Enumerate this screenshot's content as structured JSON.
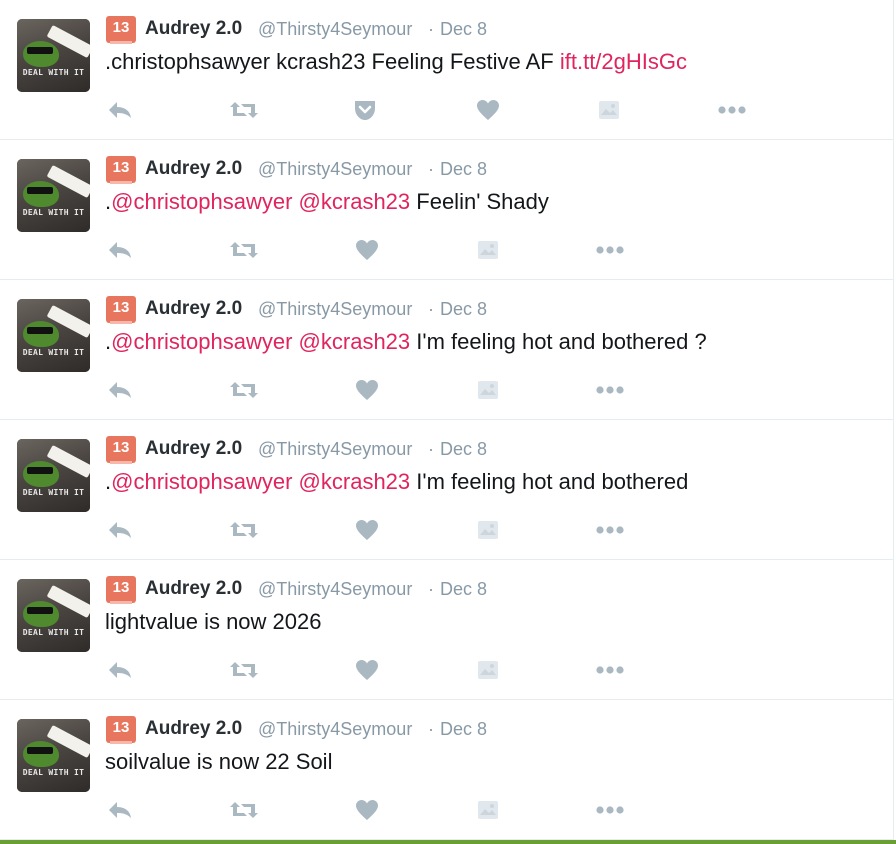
{
  "colors": {
    "accent": "#e0245e",
    "badge": "#e8765e",
    "muted": "#8899a6",
    "icon": "#aab8c2"
  },
  "tweets": [
    {
      "badge": "13",
      "name": "Audrey 2.0",
      "handle": "@Thirsty4Seymour",
      "separator": "·",
      "date": "Dec 8",
      "avatar_text": "DEAL WITH IT",
      "text_parts": [
        {
          "t": ".christophsawyer kcrash23 Feeling Festive AF ",
          "k": "plain"
        },
        {
          "t": "ift.tt/2gHIsGc",
          "k": "link"
        }
      ],
      "actions": [
        "reply-icon",
        "retweet-icon",
        "pocket-icon",
        "like-icon",
        "media-icon",
        "more-icon"
      ]
    },
    {
      "badge": "13",
      "name": "Audrey 2.0",
      "handle": "@Thirsty4Seymour",
      "separator": "·",
      "date": "Dec 8",
      "avatar_text": "DEAL WITH IT",
      "text_parts": [
        {
          "t": ".",
          "k": "plain"
        },
        {
          "t": "@christophsawyer",
          "k": "mention"
        },
        {
          "t": " ",
          "k": "plain"
        },
        {
          "t": "@kcrash23",
          "k": "mention"
        },
        {
          "t": " Feelin' Shady",
          "k": "plain"
        }
      ],
      "actions": [
        "reply-icon",
        "retweet-icon",
        "like-icon",
        "media-icon",
        "more-icon"
      ]
    },
    {
      "badge": "13",
      "name": "Audrey 2.0",
      "handle": "@Thirsty4Seymour",
      "separator": "·",
      "date": "Dec 8",
      "avatar_text": "DEAL WITH IT",
      "text_parts": [
        {
          "t": ".",
          "k": "plain"
        },
        {
          "t": "@christophsawyer",
          "k": "mention"
        },
        {
          "t": " ",
          "k": "plain"
        },
        {
          "t": "@kcrash23",
          "k": "mention"
        },
        {
          "t": " I'm feeling hot and bothered ?",
          "k": "plain"
        }
      ],
      "actions": [
        "reply-icon",
        "retweet-icon",
        "like-icon",
        "media-icon",
        "more-icon"
      ]
    },
    {
      "badge": "13",
      "name": "Audrey 2.0",
      "handle": "@Thirsty4Seymour",
      "separator": "·",
      "date": "Dec 8",
      "avatar_text": "DEAL WITH IT",
      "text_parts": [
        {
          "t": ".",
          "k": "plain"
        },
        {
          "t": "@christophsawyer",
          "k": "mention"
        },
        {
          "t": " ",
          "k": "plain"
        },
        {
          "t": "@kcrash23",
          "k": "mention"
        },
        {
          "t": " I'm feeling hot and bothered",
          "k": "plain"
        }
      ],
      "actions": [
        "reply-icon",
        "retweet-icon",
        "like-icon",
        "media-icon",
        "more-icon"
      ]
    },
    {
      "badge": "13",
      "name": "Audrey 2.0",
      "handle": "@Thirsty4Seymour",
      "separator": "·",
      "date": "Dec 8",
      "avatar_text": "DEAL WITH IT",
      "text_parts": [
        {
          "t": "lightvalue is now 2026",
          "k": "plain"
        }
      ],
      "actions": [
        "reply-icon",
        "retweet-icon",
        "like-icon",
        "media-icon",
        "more-icon"
      ]
    },
    {
      "badge": "13",
      "name": "Audrey 2.0",
      "handle": "@Thirsty4Seymour",
      "separator": "·",
      "date": "Dec 8",
      "avatar_text": "DEAL WITH IT",
      "text_parts": [
        {
          "t": "soilvalue is now 22 Soil",
          "k": "plain"
        }
      ],
      "actions": [
        "reply-icon",
        "retweet-icon",
        "like-icon",
        "media-icon",
        "more-icon"
      ]
    }
  ]
}
